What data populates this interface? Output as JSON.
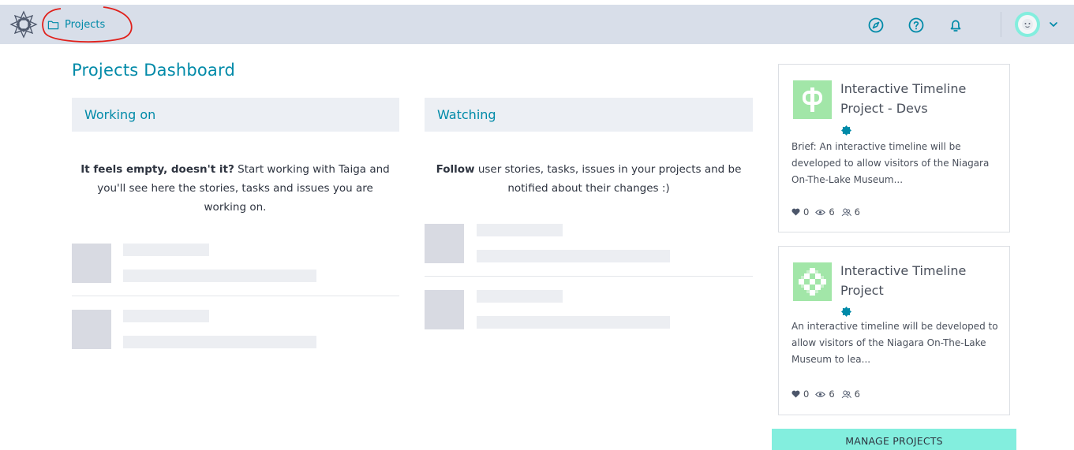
{
  "topbar": {
    "projects_label": "Projects",
    "icons": [
      "discover-icon",
      "help-icon",
      "notifications-icon"
    ]
  },
  "dashboard": {
    "title": "Projects Dashboard",
    "working_on": {
      "header": "Working on",
      "empty_bold": "It feels empty, doesn't it?",
      "empty_rest": " Start working with Taiga and you'll see here the stories, tasks and issues you are working on."
    },
    "watching": {
      "header": "Watching",
      "empty_bold": "Follow",
      "empty_rest": " user stories, tasks, issues in your projects and be notified about their changes :)"
    }
  },
  "projects": [
    {
      "title": "Interactive Timeline Project - Devs",
      "description": "Brief: An interactive timeline will be developed to allow visitors of the Niagara On-The-Lake Museum...",
      "likes": "0",
      "watchers": "6",
      "members": "6"
    },
    {
      "title": "Interactive Timeline Project",
      "description": "An interactive timeline will be developed to allow visitors of the Niagara On-The-Lake Museum to lea...",
      "likes": "0",
      "watchers": "6",
      "members": "6"
    }
  ],
  "manage_projects_label": "MANAGE PROJECTS",
  "colors": {
    "accent": "#008aa8",
    "topbar_bg": "#d8dee9",
    "button_bg": "#83eede",
    "project_tile": "#a2e6a8",
    "annotation_red": "#e0201b"
  }
}
